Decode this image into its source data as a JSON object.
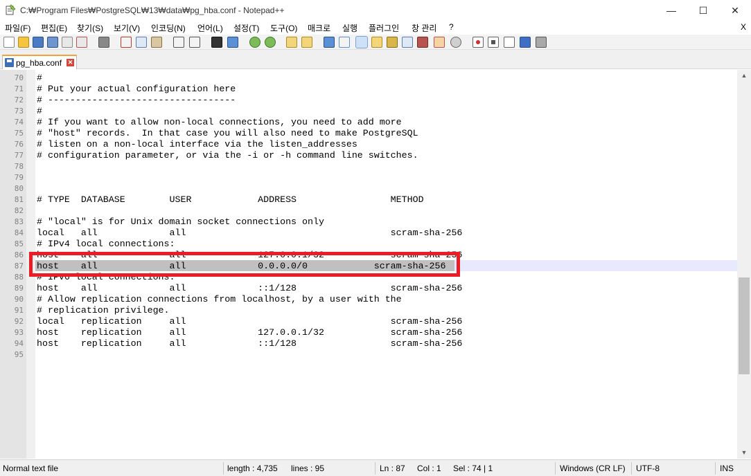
{
  "window": {
    "title": "C:₩Program Files₩PostgreSQL₩13₩data₩pg_hba.conf - Notepad++",
    "minimize": "—",
    "maximize": "☐",
    "close": "✕"
  },
  "menu": {
    "items": [
      "파일(F)",
      "편집(E)",
      "찾기(S)",
      "보기(V)",
      "인코딩(N)",
      "언어(L)",
      "설정(T)",
      "도구(O)",
      "매크로",
      "실행",
      "플러그인",
      "창 관리",
      "?"
    ],
    "close_doc": "X"
  },
  "toolbar": {
    "icons": [
      "new-file-icon",
      "open-file-icon",
      "save-icon",
      "save-all-icon",
      "close-icon",
      "close-all-icon",
      "print-icon",
      "cut-icon",
      "copy-icon",
      "paste-icon",
      "undo-icon",
      "redo-icon",
      "find-icon",
      "replace-icon",
      "zoom-in-icon",
      "zoom-out-icon",
      "sync-v-icon",
      "sync-h-icon",
      "word-wrap-icon",
      "show-all-chars-icon",
      "indent-guide-icon",
      "udl-icon",
      "doc-map-icon",
      "function-list-icon",
      "folder-workspace-icon",
      "monitoring-icon",
      "record-macro-icon",
      "stop-macro-icon",
      "play-macro-icon",
      "run-macro-multiple-icon",
      "save-macro-icon"
    ]
  },
  "tab": {
    "label": "pg_hba.conf",
    "close": "✕"
  },
  "editor": {
    "lines": [
      {
        "n": "70",
        "t": "#"
      },
      {
        "n": "71",
        "t": "# Put your actual configuration here"
      },
      {
        "n": "72",
        "t": "# ----------------------------------"
      },
      {
        "n": "73",
        "t": "#"
      },
      {
        "n": "74",
        "t": "# If you want to allow non-local connections, you need to add more"
      },
      {
        "n": "75",
        "t": "# \"host\" records.  In that case you will also need to make PostgreSQL"
      },
      {
        "n": "76",
        "t": "# listen on a non-local interface via the listen_addresses"
      },
      {
        "n": "77",
        "t": "# configuration parameter, or via the -i or -h command line switches."
      },
      {
        "n": "78",
        "t": ""
      },
      {
        "n": "79",
        "t": ""
      },
      {
        "n": "80",
        "t": ""
      },
      {
        "n": "81",
        "t": "# TYPE  DATABASE        USER            ADDRESS                 METHOD"
      },
      {
        "n": "82",
        "t": ""
      },
      {
        "n": "83",
        "t": "# \"local\" is for Unix domain socket connections only"
      },
      {
        "n": "84",
        "t": "local   all             all                                     scram-sha-256"
      },
      {
        "n": "85",
        "t": "# IPv4 local connections:"
      },
      {
        "n": "86",
        "t": "host    all             all             127.0.0.1/32            scram-sha-256"
      },
      {
        "n": "87",
        "t": "host    all             all             0.0.0.0/0            scram-sha-256"
      },
      {
        "n": "88",
        "t": "# IPv6 local connections:"
      },
      {
        "n": "89",
        "t": "host    all             all             ::1/128                 scram-sha-256"
      },
      {
        "n": "90",
        "t": "# Allow replication connections from localhost, by a user with the"
      },
      {
        "n": "91",
        "t": "# replication privilege."
      },
      {
        "n": "92",
        "t": "local   replication     all                                     scram-sha-256"
      },
      {
        "n": "93",
        "t": "host    replication     all             127.0.0.1/32            scram-sha-256"
      },
      {
        "n": "94",
        "t": "host    replication     all             ::1/128                 scram-sha-256"
      },
      {
        "n": "95",
        "t": ""
      }
    ],
    "current_line": "87"
  },
  "status": {
    "file_type": "Normal text file",
    "length": "length : 4,735",
    "lines": "lines : 95",
    "ln": "Ln : 87",
    "col": "Col : 1",
    "sel": "Sel : 74 | 1",
    "eol": "Windows (CR LF)",
    "encoding": "UTF-8",
    "mode": "INS"
  },
  "colors": {
    "highlight_box": "#ed1c24",
    "current_line_bg": "#e8e8ff",
    "selection_bg": "#c0c0c0"
  }
}
